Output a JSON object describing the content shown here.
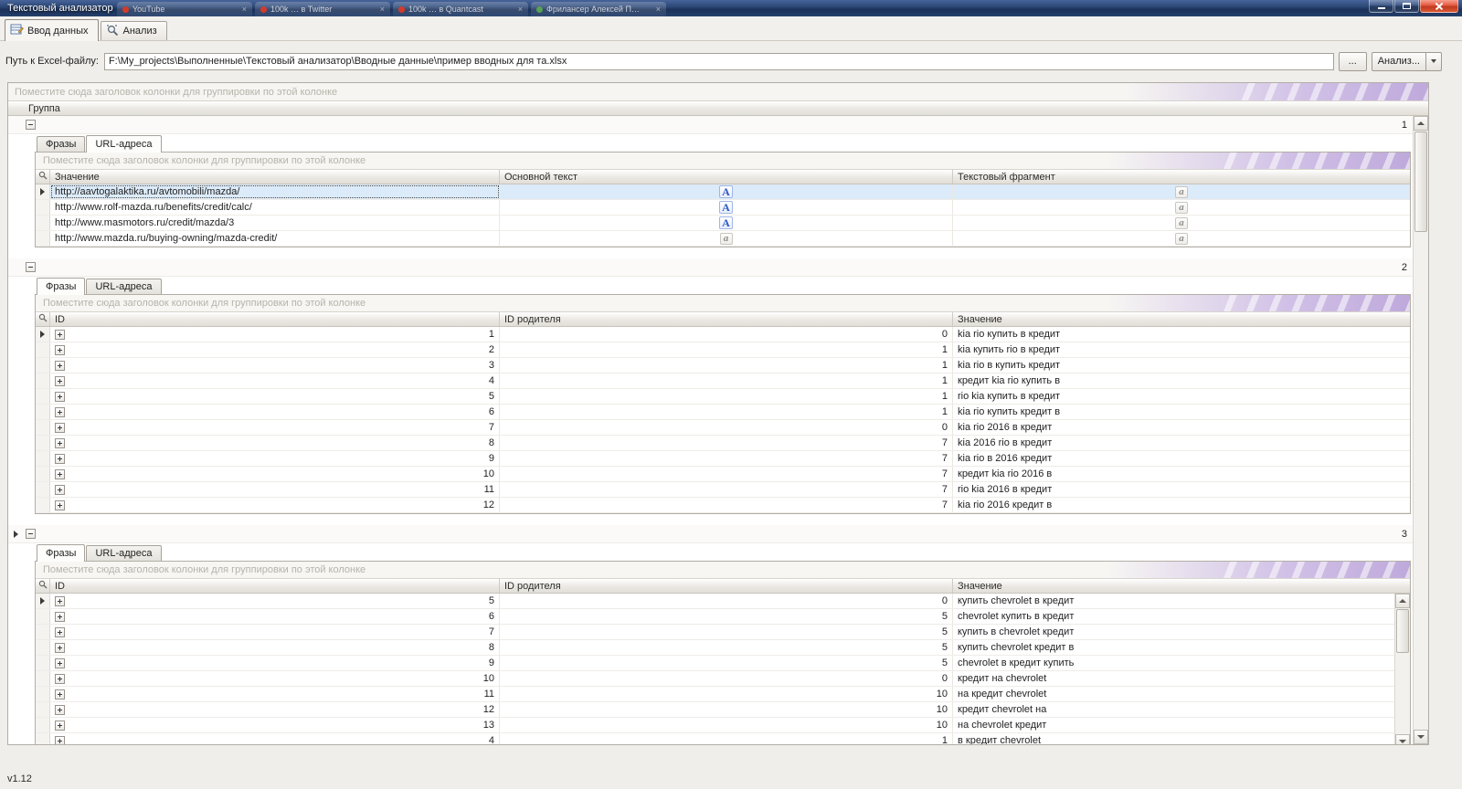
{
  "window": {
    "title": "Текстовый анализатор",
    "ghost_tabs": [
      {
        "label": "YouTube",
        "color": "#d33a2c"
      },
      {
        "label": "100k … в Twitter",
        "color": "#d33a2c"
      },
      {
        "label": "100k … в Quantcast",
        "color": "#d33a2c"
      },
      {
        "label": "Фрилансер Алексей П…",
        "color": "#56a256"
      }
    ],
    "controls": {
      "minimize": "minimize",
      "maximize": "maximize",
      "close": "close"
    }
  },
  "main_tabs": [
    {
      "label": "Ввод данных"
    },
    {
      "label": "Анализ"
    }
  ],
  "toolbar": {
    "path_label": "Путь к Excel-файлу:",
    "path_value": "F:\\My_projects\\Выполненные\\Текстовый анализатор\\Вводные данные\\пример вводных для та.xlsx",
    "browse_label": "...",
    "analyze_label": "Анализ..."
  },
  "grid": {
    "group_panel_text": "Поместите сюда заголовок колонки для группировки по этой колонке",
    "column_header": "Группа",
    "groups": [
      {
        "number": "1",
        "tabs": [
          "Фразы",
          "URL-адреса"
        ],
        "active_tab": 1,
        "type": "urls",
        "columns": [
          "Значение",
          "Основной текст",
          "Текстовый фрагмент"
        ],
        "rows": [
          {
            "value": "http://aavtogalaktika.ru/avtomobili/mazda/",
            "main": "A",
            "fragment": "a",
            "selected": true,
            "arrow": true
          },
          {
            "value": "http://www.rolf-mazda.ru/benefits/credit/calc/",
            "main": "A",
            "fragment": "a"
          },
          {
            "value": "http://www.masmotors.ru/credit/mazda/3",
            "main": "A",
            "fragment": "a"
          },
          {
            "value": "http://www.mazda.ru/buying-owning/mazda-credit/",
            "main": "a",
            "fragment": "a"
          }
        ]
      },
      {
        "number": "2",
        "tabs": [
          "Фразы",
          "URL-адреса"
        ],
        "active_tab": 0,
        "type": "phrases",
        "columns": [
          "ID",
          "ID родителя",
          "Значение"
        ],
        "rows": [
          {
            "id": "1",
            "parent": "0",
            "value": "kia rio купить в кредит",
            "arrow": true
          },
          {
            "id": "2",
            "parent": "1",
            "value": "kia купить rio в кредит"
          },
          {
            "id": "3",
            "parent": "1",
            "value": "kia rio в купить кредит"
          },
          {
            "id": "4",
            "parent": "1",
            "value": "кредит kia rio купить в"
          },
          {
            "id": "5",
            "parent": "1",
            "value": "rio kia купить в кредит"
          },
          {
            "id": "6",
            "parent": "1",
            "value": "kia rio купить кредит в"
          },
          {
            "id": "7",
            "parent": "0",
            "value": "kia rio 2016 в кредит"
          },
          {
            "id": "8",
            "parent": "7",
            "value": "kia 2016 rio в кредит"
          },
          {
            "id": "9",
            "parent": "7",
            "value": "kia rio в 2016 кредит"
          },
          {
            "id": "10",
            "parent": "7",
            "value": "кредит kia rio 2016 в"
          },
          {
            "id": "11",
            "parent": "7",
            "value": "rio kia 2016 в кредит"
          },
          {
            "id": "12",
            "parent": "7",
            "value": "kia rio 2016 кредит в"
          }
        ]
      },
      {
        "number": "3",
        "marker": true,
        "has_scrollbar": true,
        "tabs": [
          "Фразы",
          "URL-адреса"
        ],
        "active_tab": 0,
        "type": "phrases",
        "columns": [
          "ID",
          "ID родителя",
          "Значение"
        ],
        "rows": [
          {
            "id": "5",
            "parent": "0",
            "value": "купить chevrolet в кредит",
            "arrow": true
          },
          {
            "id": "6",
            "parent": "5",
            "value": "chevrolet купить в кредит"
          },
          {
            "id": "7",
            "parent": "5",
            "value": "купить в chevrolet кредит"
          },
          {
            "id": "8",
            "parent": "5",
            "value": "купить chevrolet кредит в"
          },
          {
            "id": "9",
            "parent": "5",
            "value": "chevrolet в кредит купить"
          },
          {
            "id": "10",
            "parent": "0",
            "value": "кредит на chevrolet"
          },
          {
            "id": "11",
            "parent": "10",
            "value": "на кредит chevrolet"
          },
          {
            "id": "12",
            "parent": "10",
            "value": "кредит chevrolet на"
          },
          {
            "id": "13",
            "parent": "10",
            "value": "на chevrolet кредит"
          },
          {
            "id": "4",
            "parent": "1",
            "value": "в кредит chevrolet"
          }
        ]
      }
    ]
  },
  "statusbar": {
    "version": "v1.12"
  }
}
